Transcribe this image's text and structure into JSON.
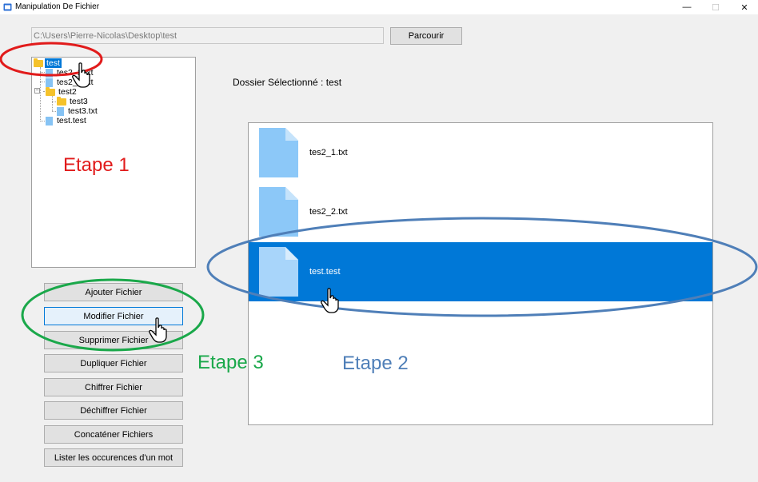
{
  "window": {
    "title": "Manipulation De Fichier",
    "min_label": "—",
    "max_label": "☐",
    "close_label": "✕"
  },
  "path": {
    "value": "C:\\Users\\Pierre-Nicolas\\Desktop\\test"
  },
  "browse_button": "Parcourir",
  "tree": {
    "root": "test",
    "items": [
      "tes2_1.txt",
      "tes2_2.txt",
      "test2",
      "test3",
      "test3.txt",
      "test.test"
    ]
  },
  "selected_folder_label": "Dossier Sélectionné : test",
  "files": [
    "tes2_1.txt",
    "tes2_2.txt",
    "test.test"
  ],
  "actions": [
    "Ajouter Fichier",
    "Modifier Fichier",
    "Supprimer Fichier",
    "Dupliquer Fichier",
    "Chiffrer Fichier",
    "Déchiffrer Fichier",
    "Concaténer Fichiers",
    "Lister les occurences d'un mot"
  ],
  "annotations": {
    "etape1": "Etape 1",
    "etape2": "Etape 2",
    "etape3": "Etape 3"
  },
  "colors": {
    "accent": "#0078d7",
    "etape1": "#e11b1b",
    "etape2": "#4f7fb8",
    "etape3": "#1aa84a",
    "file_icon": "#86c3f4",
    "folder_icon": "#f5c22b"
  }
}
